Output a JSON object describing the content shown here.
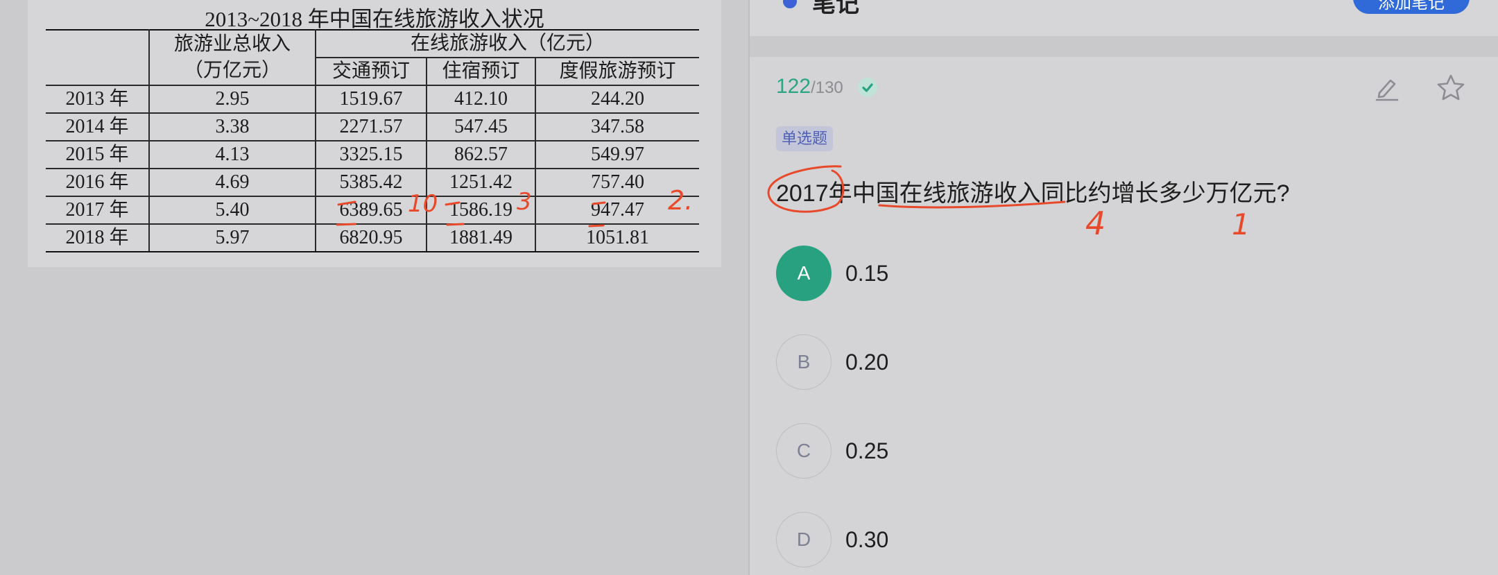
{
  "table": {
    "title": "2013~2018 年中国在线旅游收入状况",
    "header": {
      "total_income_line1": "旅游业总收入",
      "total_income_line2": "（万亿元）",
      "online_group": "在线旅游收入（亿元）",
      "col_transport": "交通预订",
      "col_lodging": "住宿预订",
      "col_vacation": "度假旅游预订"
    },
    "rows": [
      {
        "year": "2013 年",
        "total": "2.95",
        "transport": "1519.67",
        "lodging": "412.10",
        "vacation": "244.20"
      },
      {
        "year": "2014 年",
        "total": "3.38",
        "transport": "2271.57",
        "lodging": "547.45",
        "vacation": "347.58"
      },
      {
        "year": "2015 年",
        "total": "4.13",
        "transport": "3325.15",
        "lodging": "862.57",
        "vacation": "549.97"
      },
      {
        "year": "2016 年",
        "total": "4.69",
        "transport": "5385.42",
        "lodging": "1251.42",
        "vacation": "757.40"
      },
      {
        "year": "2017 年",
        "total": "5.40",
        "transport": "6389.65",
        "lodging": "1586.19",
        "vacation": "947.47"
      },
      {
        "year": "2018 年",
        "total": "5.97",
        "transport": "6820.95",
        "lodging": "1881.49",
        "vacation": "1051.81"
      }
    ]
  },
  "annotations": {
    "note_10": "10",
    "note_3": "3",
    "note_2": "2.",
    "note_4": "4",
    "note_1": "1",
    "ink_color": "#e8492b"
  },
  "top_bar": {
    "notes_label": "笔记",
    "add_note_button": "添加笔记"
  },
  "question": {
    "progress_current": "122",
    "progress_total": "/130",
    "type_badge": "单选题",
    "text": "2017年中国在线旅游收入同比约增长多少万亿元?",
    "options": [
      {
        "letter": "A",
        "text": "0.15",
        "selected": true
      },
      {
        "letter": "B",
        "text": "0.20",
        "selected": false
      },
      {
        "letter": "C",
        "text": "0.25",
        "selected": false
      },
      {
        "letter": "D",
        "text": "0.30",
        "selected": false
      }
    ]
  },
  "colors": {
    "accent_green": "#27a17f",
    "primary_blue": "#2f6ad8",
    "badge_text": "#4e60b8"
  }
}
